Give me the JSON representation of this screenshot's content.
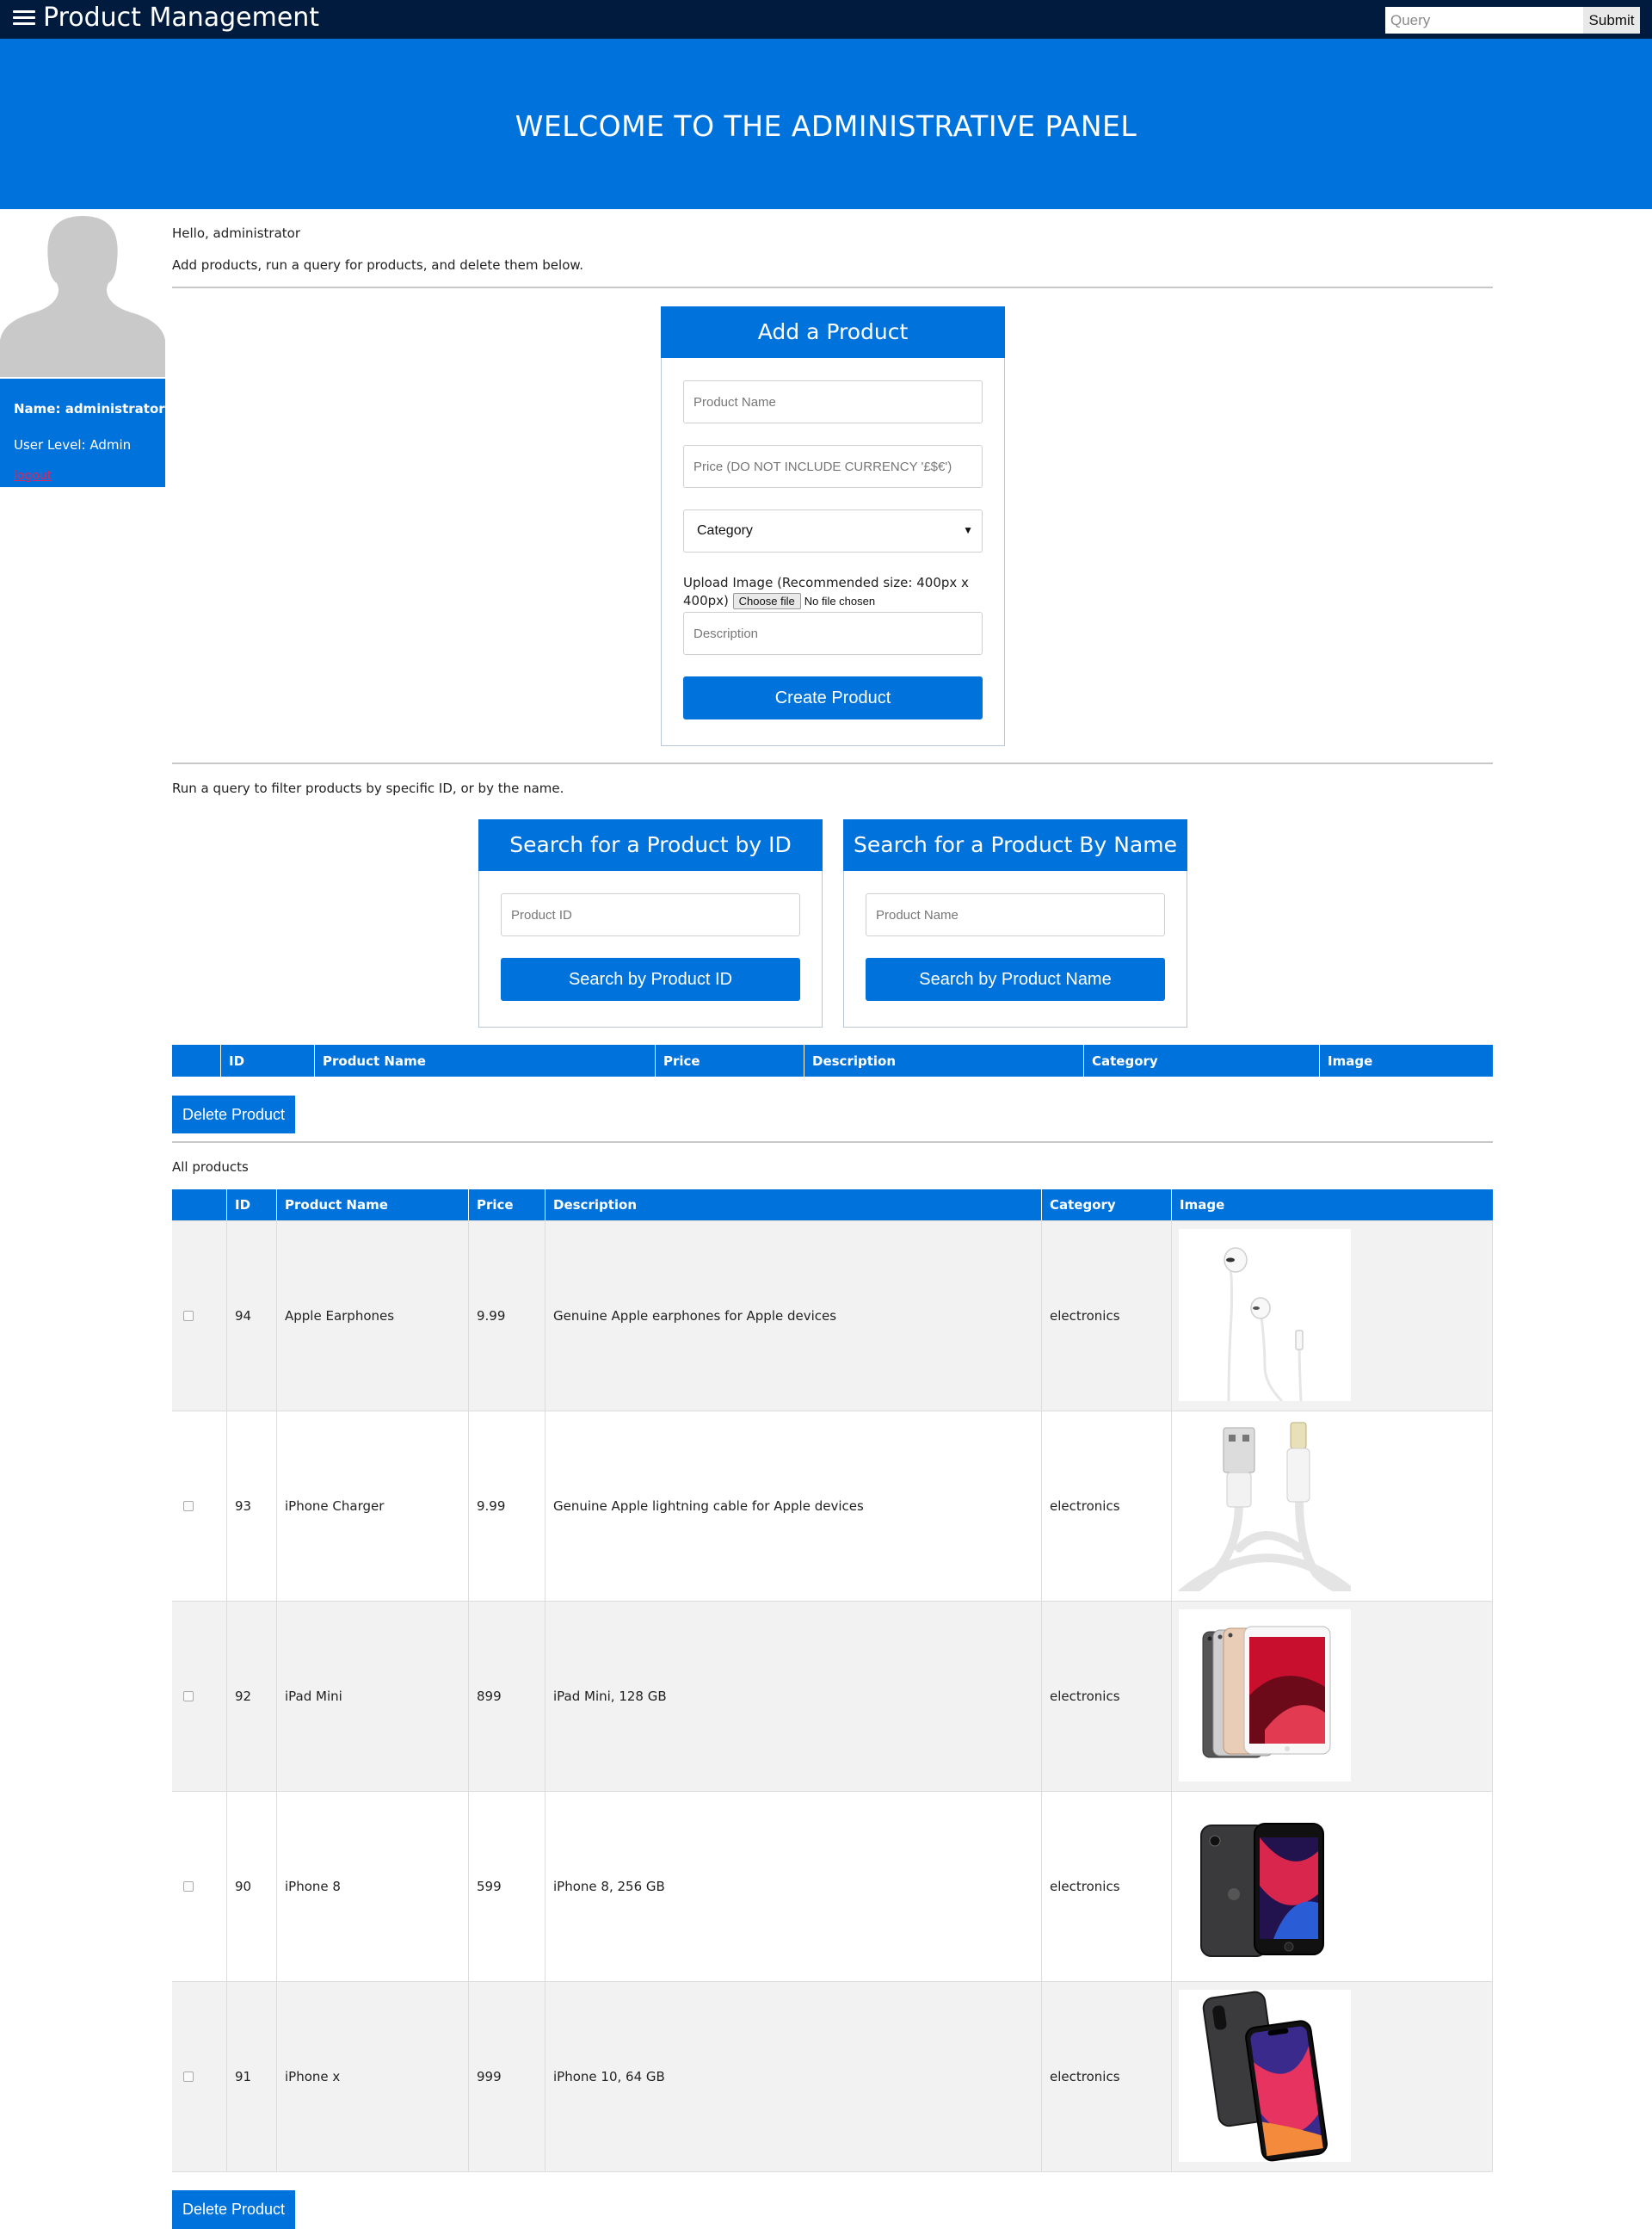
{
  "nav": {
    "title": "Product Management",
    "menu_icon": "hamburger-icon",
    "query_placeholder": "Query",
    "submit_label": "Submit"
  },
  "banner": {
    "heading": "WELCOME TO THE ADMINISTRATIVE PANEL"
  },
  "profile": {
    "avatar_icon": "user-silhouette-icon",
    "name": "Name: administrator",
    "level": "User Level: Admin",
    "logout": "logout"
  },
  "intro": {
    "greeting": "Hello, administrator",
    "instructions": "Add products, run a query for products, and delete them below."
  },
  "add_form": {
    "title": "Add a Product",
    "name_placeholder": "Product Name",
    "price_placeholder": "Price (DO NOT INCLUDE CURRENCY '£$€')",
    "category_value": "Category",
    "upload_label": "Upload Image (Recommended size: 400px x 400px)",
    "choose_file": "Choose file",
    "file_status": "No file chosen",
    "description_placeholder": "Description",
    "submit_label": "Create Product"
  },
  "query_intro": "Run a query to filter products by specific ID, or by the name.",
  "search_id": {
    "title": "Search for a Product by ID",
    "placeholder": "Product ID",
    "button": "Search by Product ID"
  },
  "search_name": {
    "title": "Search for a Product By Name",
    "placeholder": "Product Name",
    "button": "Search by Product Name"
  },
  "table_headers": [
    "ID",
    "Product Name",
    "Price",
    "Description",
    "Category",
    "Image"
  ],
  "delete_label": "Delete Product",
  "all_products_label": "All products",
  "products": [
    {
      "id": "94",
      "name": "Apple Earphones",
      "price": "9.99",
      "description": "Genuine Apple earphones for Apple devices",
      "category": "electronics",
      "image_icon": "earphones-image"
    },
    {
      "id": "93",
      "name": "iPhone Charger",
      "price": "9.99",
      "description": "Genuine Apple lightning cable for Apple devices",
      "category": "electronics",
      "image_icon": "lightning-cable-image"
    },
    {
      "id": "92",
      "name": "iPad Mini",
      "price": "899",
      "description": "iPad Mini, 128 GB",
      "category": "electronics",
      "image_icon": "ipad-mini-image"
    },
    {
      "id": "90",
      "name": "iPhone 8",
      "price": "599",
      "description": "iPhone 8, 256 GB",
      "category": "electronics",
      "image_icon": "iphone-8-image"
    },
    {
      "id": "91",
      "name": "iPhone x",
      "price": "999",
      "description": "iPhone 10, 64 GB",
      "category": "electronics",
      "image_icon": "iphone-x-image"
    }
  ],
  "colors": {
    "nav": "#001b3d",
    "accent": "#0072db",
    "logout": "#e0245e"
  }
}
